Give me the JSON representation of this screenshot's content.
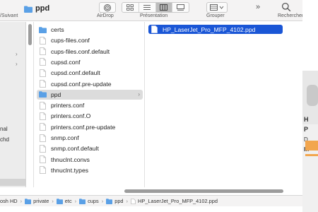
{
  "toolbar": {
    "back_forward_label": "/Suivant",
    "title": "ppd",
    "airdrop_label": "AirDrop",
    "views_label": "Présentation",
    "group_label": "Grouper",
    "more_label": "»",
    "search_label": "Rechercher"
  },
  "sidebar": {
    "text_1": "nal",
    "text_2": "chd"
  },
  "column_2": {
    "items": [
      {
        "name": "certs",
        "type": "folder"
      },
      {
        "name": "cups-files.conf",
        "type": "file"
      },
      {
        "name": "cups-files.conf.default",
        "type": "file"
      },
      {
        "name": "cupsd.conf",
        "type": "file"
      },
      {
        "name": "cupsd.conf.default",
        "type": "file"
      },
      {
        "name": "cupsd.conf.pre-update",
        "type": "file"
      },
      {
        "name": "ppd",
        "type": "folder",
        "selected": true
      },
      {
        "name": "printers.conf",
        "type": "file"
      },
      {
        "name": "printers.conf.O",
        "type": "file"
      },
      {
        "name": "printers.conf.pre-update",
        "type": "file"
      },
      {
        "name": "snmp.conf",
        "type": "file"
      },
      {
        "name": "snmp.conf.default",
        "type": "file"
      },
      {
        "name": "thnuclnt.convs",
        "type": "file"
      },
      {
        "name": "thnuclnt.types",
        "type": "file"
      }
    ]
  },
  "column_3": {
    "selected_file": "HP_LaserJet_Pro_MFP_4102.ppd"
  },
  "pathbar": {
    "crumbs": [
      "osh HD",
      "private",
      "etc",
      "cups",
      "ppd",
      "HP_LaserJet_Pro_MFP_4102.ppd"
    ]
  },
  "background_window": {
    "letter_1": "H",
    "letter_2": "P",
    "letter_3": "D",
    "letter_4": "In"
  },
  "colors": {
    "selection_blue": "#1a56d6",
    "folder_blue": "#5aa0e6",
    "accent_orange": "#f2a64e"
  }
}
